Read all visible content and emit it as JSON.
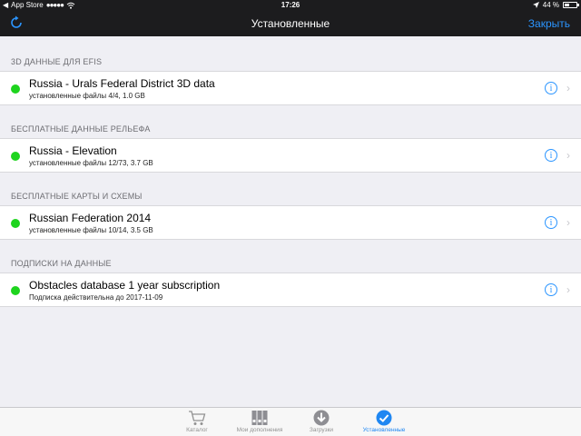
{
  "status_bar": {
    "back_app": "App Store",
    "signal": "●●●●●",
    "time": "17:26",
    "battery_text": "44 %",
    "battery_level": 0.44
  },
  "nav": {
    "title": "Установленные",
    "close_label": "Закрыть"
  },
  "sections": [
    {
      "header": "3D ДАННЫЕ ДЛЯ EFIS",
      "item": {
        "title": "Russia - Urals Federal District 3D data",
        "subtitle": "установленные файлы 4/4, 1.0 GB"
      }
    },
    {
      "header": "БЕСПЛАТНЫЕ ДАННЫЕ РЕЛЬЕФА",
      "item": {
        "title": "Russia - Elevation",
        "subtitle": "установленные файлы 12/73, 3.7 GB"
      }
    },
    {
      "header": "БЕСПЛАТНЫЕ КАРТЫ И СХЕМЫ",
      "item": {
        "title": "Russian Federation 2014",
        "subtitle": "установленные файлы 10/14, 3.5 GB"
      }
    },
    {
      "header": "ПОДПИСКИ НА ДАННЫЕ",
      "item": {
        "title": "Obstacles database 1 year subscription",
        "subtitle": "Подписка действительна до 2017-11-09"
      }
    }
  ],
  "tabs": [
    {
      "label": "Каталог",
      "icon": "cart-icon"
    },
    {
      "label": "Мои дополнения",
      "icon": "binders-icon"
    },
    {
      "label": "Загрузки",
      "icon": "download-icon"
    },
    {
      "label": "Установленные",
      "icon": "checkmark-icon",
      "active": true
    }
  ],
  "colors": {
    "accent": "#2b95ff",
    "status_dot": "#1ed41e",
    "bar_bg": "#1c1c1e"
  }
}
